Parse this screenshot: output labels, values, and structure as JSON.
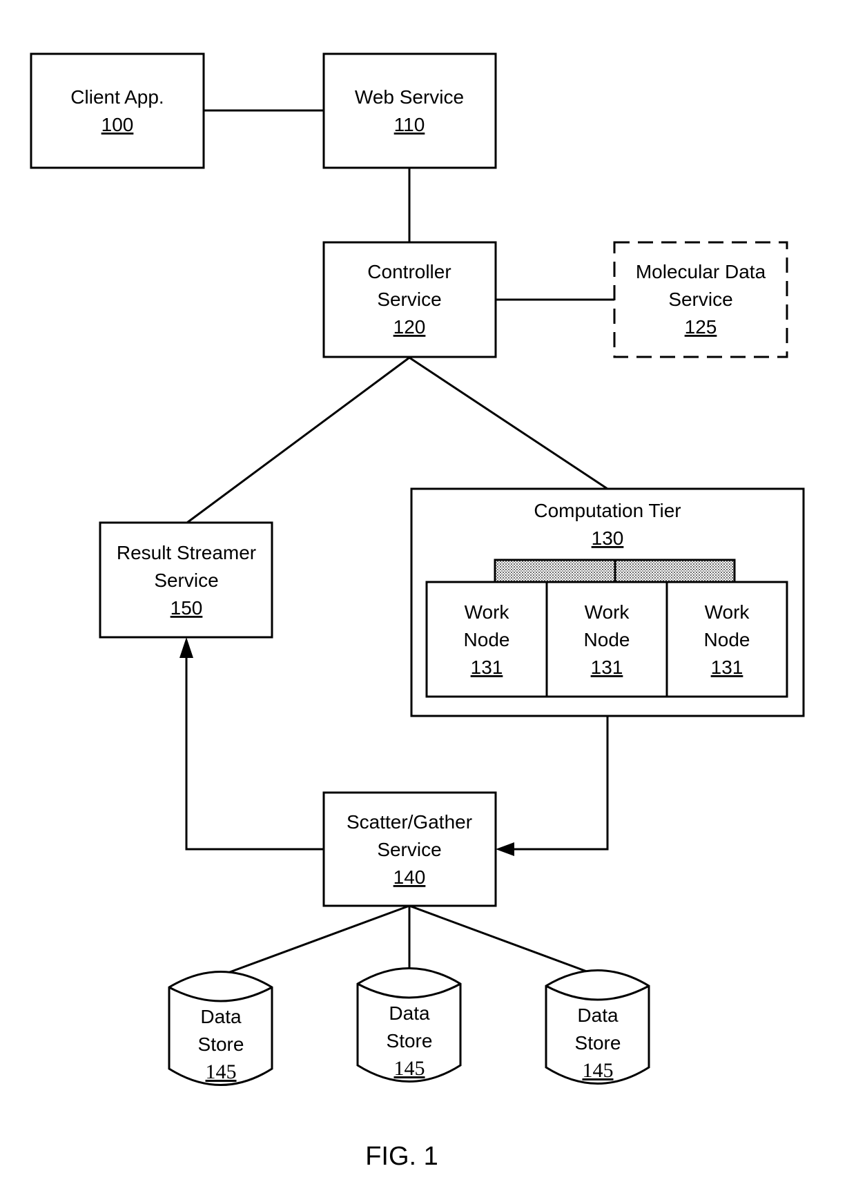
{
  "figure": {
    "caption": "FIG. 1",
    "colors": {
      "stroke": "#000000",
      "background": "#ffffff",
      "shade": "#b0b0b0"
    }
  },
  "nodes": {
    "client_app": {
      "lines": [
        "Client App."
      ],
      "ref": "100"
    },
    "web_service": {
      "lines": [
        "Web Service"
      ],
      "ref": "110"
    },
    "controller_service": {
      "lines": [
        "Controller",
        "Service"
      ],
      "ref": "120"
    },
    "molecular_data_service": {
      "lines": [
        "Molecular Data",
        "Service"
      ],
      "ref": "125",
      "style": "dashed"
    },
    "computation_tier": {
      "lines": [
        "Computation Tier"
      ],
      "ref": "130"
    },
    "work_nodes": [
      {
        "lines": [
          "Work",
          "Node"
        ],
        "ref": "131"
      },
      {
        "lines": [
          "Work",
          "Node"
        ],
        "ref": "131"
      },
      {
        "lines": [
          "Work",
          "Node"
        ],
        "ref": "131"
      }
    ],
    "result_streamer_service": {
      "lines": [
        "Result Streamer",
        "Service"
      ],
      "ref": "150"
    },
    "scatter_gather_service": {
      "lines": [
        "Scatter/Gather",
        "Service"
      ],
      "ref": "140"
    },
    "data_stores": [
      {
        "lines": [
          "Data",
          "Store"
        ],
        "ref": "145"
      },
      {
        "lines": [
          "Data",
          "Store"
        ],
        "ref": "145"
      },
      {
        "lines": [
          "Data",
          "Store"
        ],
        "ref": "145"
      }
    ]
  },
  "edges": [
    {
      "from": "client_app",
      "to": "web_service",
      "type": "line"
    },
    {
      "from": "web_service",
      "to": "controller_service",
      "type": "line"
    },
    {
      "from": "controller_service",
      "to": "molecular_data_service",
      "type": "line"
    },
    {
      "from": "controller_service",
      "to": "result_streamer_service",
      "type": "line"
    },
    {
      "from": "controller_service",
      "to": "computation_tier",
      "type": "line"
    },
    {
      "from": "computation_tier",
      "to": "scatter_gather_service",
      "type": "arrow"
    },
    {
      "from": "scatter_gather_service",
      "to": "result_streamer_service",
      "type": "arrow"
    },
    {
      "from": "scatter_gather_service",
      "to": "data_stores.0",
      "type": "line"
    },
    {
      "from": "scatter_gather_service",
      "to": "data_stores.1",
      "type": "line"
    },
    {
      "from": "scatter_gather_service",
      "to": "data_stores.2",
      "type": "line"
    }
  ]
}
